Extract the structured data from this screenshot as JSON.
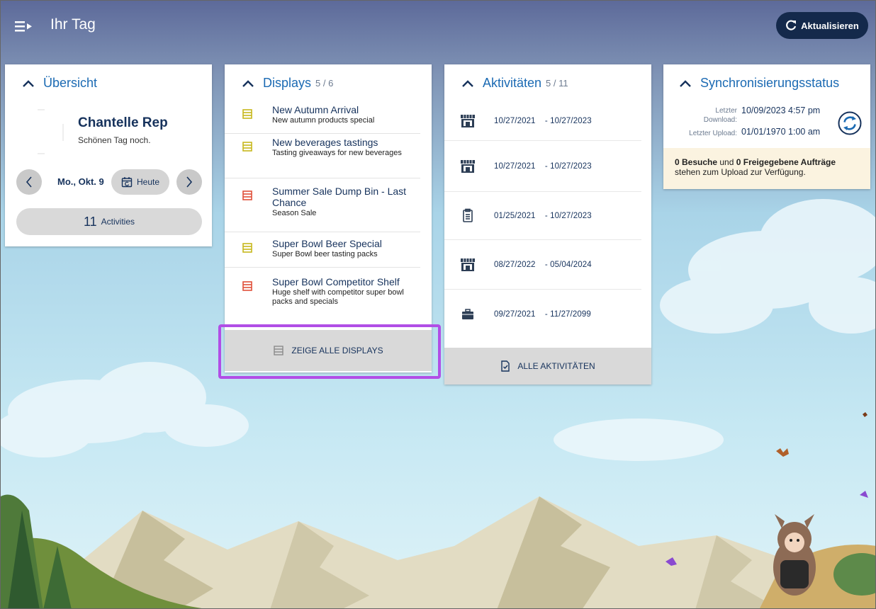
{
  "header": {
    "title": "Ihr Tag",
    "refresh_label": "Aktualisieren"
  },
  "overview": {
    "title": "Übersicht",
    "user_name": "Chantelle Rep",
    "greeting": "Schönen Tag noch.",
    "date": "Mo., Okt. 9",
    "today_label": "Heute",
    "activities_count": "11",
    "activities_label": "Activities"
  },
  "displays": {
    "title": "Displays",
    "count": "5 / 6",
    "items": [
      {
        "title": "New Autumn Arrival",
        "subtitle": "New autumn products special",
        "status_color": "#c7b81d"
      },
      {
        "title": "New beverages tastings",
        "subtitle": "Tasting giveaways for new beverages",
        "status_color": "#c7b81d"
      },
      {
        "title": "Summer Sale Dump Bin - Last Chance",
        "subtitle": "Season Sale",
        "status_color": "#e0503a"
      },
      {
        "title": "Super Bowl Beer Special",
        "subtitle": "Super Bowl beer tasting packs",
        "status_color": "#c7b81d"
      },
      {
        "title": "Super Bowl Competitor Shelf",
        "subtitle": "Huge shelf with competitor super bowl packs and specials",
        "status_color": "#e0503a"
      }
    ],
    "show_all_label": "ZEIGE ALLE DISPLAYS"
  },
  "activities": {
    "title": "Aktivitäten",
    "count": "5 / 11",
    "items": [
      {
        "icon": "store-icon",
        "start": "10/27/2021",
        "end": "- 10/27/2023"
      },
      {
        "icon": "store-icon",
        "start": "10/27/2021",
        "end": "- 10/27/2023"
      },
      {
        "icon": "checklist-icon",
        "start": "01/25/2021",
        "end": "- 10/27/2023"
      },
      {
        "icon": "store-icon",
        "start": "08/27/2022",
        "end": "- 05/04/2024"
      },
      {
        "icon": "briefcase-icon",
        "start": "09/27/2021",
        "end": "- 11/27/2099"
      }
    ],
    "all_label": "ALLE AKTIVITÄTEN"
  },
  "sync": {
    "title": "Synchronisierungsstatus",
    "last_download_label_1": "Letzter",
    "last_download_label_2": "Download:",
    "last_download_value": "10/09/2023 4:57 pm",
    "last_upload_label": "Letzter Upload:",
    "last_upload_value": "01/01/1970 1:00 am",
    "visits_count": "0 Besuche",
    "and_text": "und",
    "orders_count": "0 Freigegebene Aufträge",
    "upload_text": "stehen zum Upload zur Verfügung."
  },
  "colors": {
    "accent": "#1b6ab3",
    "header_button": "#14294b",
    "highlight": "#b14ee6"
  }
}
